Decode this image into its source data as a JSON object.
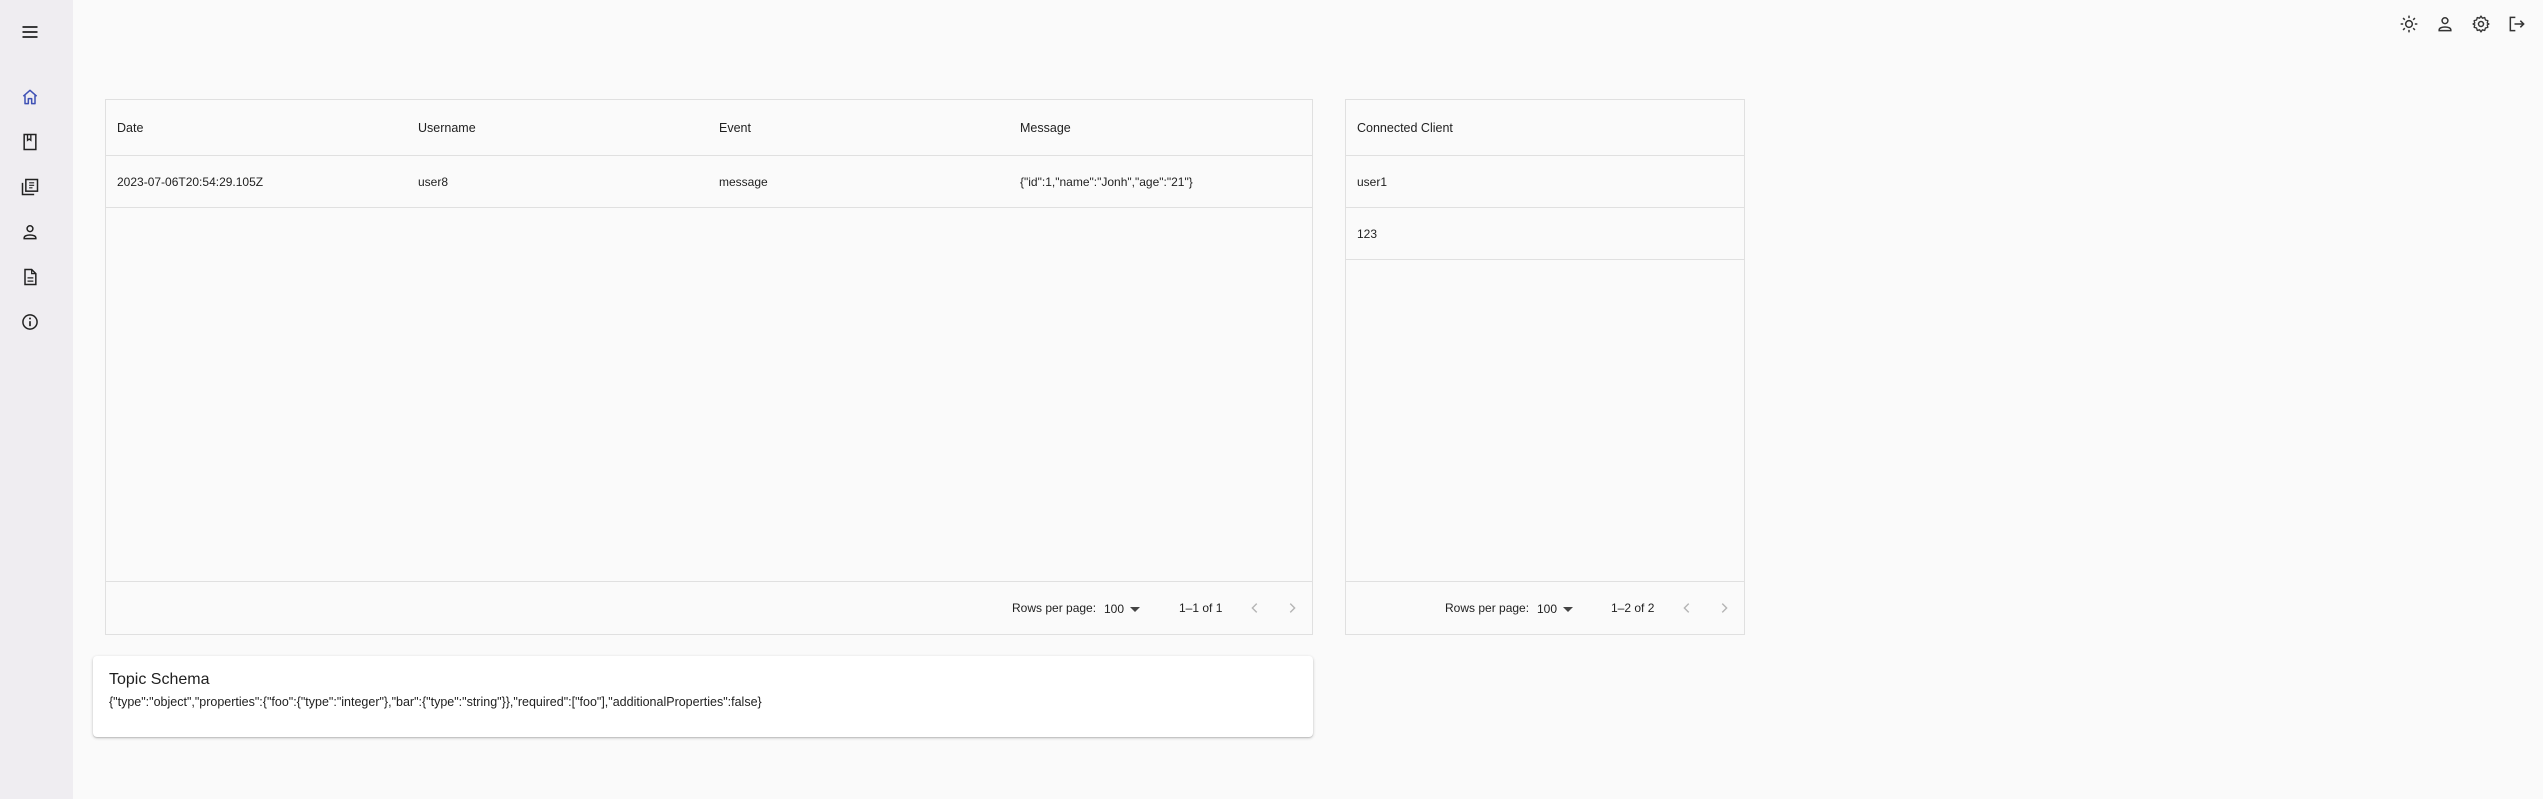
{
  "colors": {
    "sidebar_bg": "#efedf1",
    "active_icon": "#3f51b5",
    "icon": "#222222"
  },
  "sidebar": {
    "items": [
      {
        "name": "menu",
        "icon": "menu-icon"
      },
      {
        "name": "home",
        "icon": "home-icon",
        "active": true
      },
      {
        "name": "topic",
        "icon": "book-icon"
      },
      {
        "name": "topics",
        "icon": "library-icon"
      },
      {
        "name": "users",
        "icon": "person-icon"
      },
      {
        "name": "documents",
        "icon": "document-icon"
      },
      {
        "name": "info",
        "icon": "info-icon"
      }
    ]
  },
  "topbar": {
    "icons": [
      "sun-icon",
      "person-icon",
      "gear-icon",
      "logout-icon"
    ]
  },
  "events_table": {
    "headers": {
      "date": "Date",
      "username": "Username",
      "event": "Event",
      "message": "Message"
    },
    "rows": [
      {
        "date": "2023-07-06T20:54:29.105Z",
        "username": "user8",
        "event": "message",
        "message": "{\"id\":1,\"name\":\"Jonh\",\"age\":\"21\"}"
      }
    ],
    "footer": {
      "rows_per_page_label": "Rows per page:",
      "rows_per_page": "100",
      "range": "1–1 of 1"
    }
  },
  "clients_table": {
    "header": "Connected Client",
    "rows": [
      "user1",
      "123"
    ],
    "footer": {
      "rows_per_page_label": "Rows per page:",
      "rows_per_page": "100",
      "range": "1–2 of 2"
    }
  },
  "schema": {
    "title": "Topic Schema",
    "body": "{\"type\":\"object\",\"properties\":{\"foo\":{\"type\":\"integer\"},\"bar\":{\"type\":\"string\"}},\"required\":[\"foo\"],\"additionalProperties\":false}"
  }
}
